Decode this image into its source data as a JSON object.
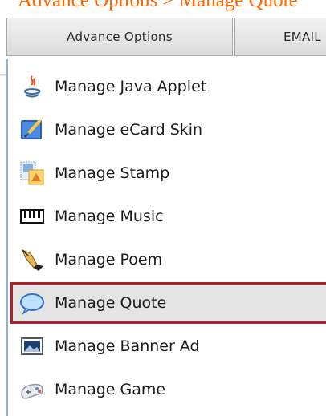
{
  "breadcrumb": "Advance Options  > Manage Quote",
  "tabs": {
    "advance": "Advance Options",
    "email": "EMAIL"
  },
  "menu": {
    "items": [
      {
        "label": "Manage Java Applet",
        "icon": "java-icon"
      },
      {
        "label": "Manage eCard Skin",
        "icon": "paintbrush-icon"
      },
      {
        "label": "Manage Stamp",
        "icon": "stamp-icon"
      },
      {
        "label": "Manage Music",
        "icon": "piano-keyboard-icon"
      },
      {
        "label": "Manage Poem",
        "icon": "fountain-pen-icon"
      },
      {
        "label": "Manage Quote",
        "icon": "speech-bubble-icon",
        "selected": true
      },
      {
        "label": "Manage Banner Ad",
        "icon": "image-icon"
      },
      {
        "label": "Manage Game",
        "icon": "gamepad-icon"
      }
    ]
  },
  "colors": {
    "breadcrumb": "#ff6600",
    "selected_border": "#b0202c",
    "selected_bg": "#e4e4e4",
    "menu_border": "#8fb2d6"
  }
}
